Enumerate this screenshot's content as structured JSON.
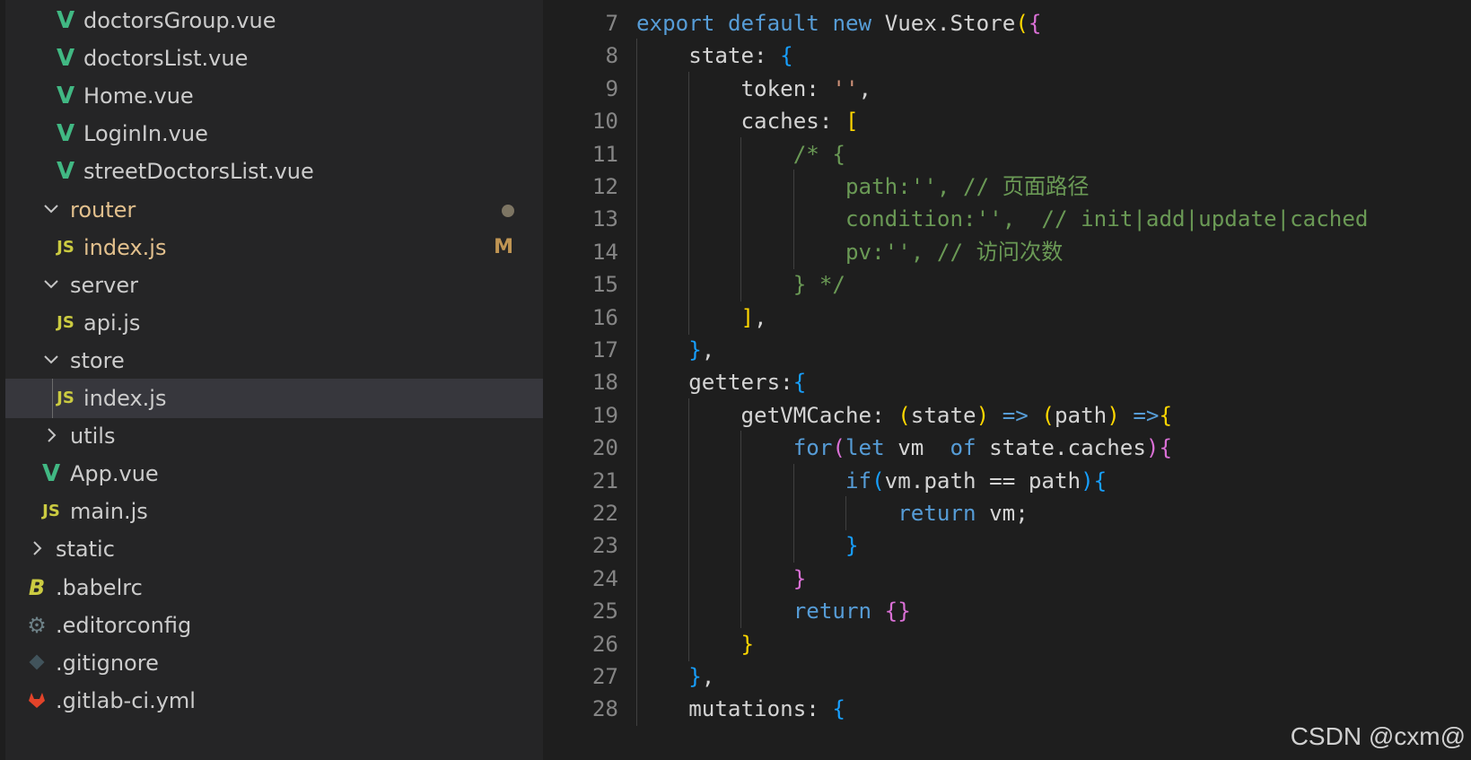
{
  "explorer": {
    "items": [
      {
        "label": "doctorsGroup.vue",
        "icon": "vue-icon",
        "indent": 2
      },
      {
        "label": "doctorsList.vue",
        "icon": "vue-icon",
        "indent": 2
      },
      {
        "label": "Home.vue",
        "icon": "vue-icon",
        "indent": 2
      },
      {
        "label": "LoginIn.vue",
        "icon": "vue-icon",
        "indent": 2
      },
      {
        "label": "streetDoctorsList.vue",
        "icon": "vue-icon",
        "indent": 2
      },
      {
        "label": "router",
        "icon": "chevron-down-icon",
        "indent": 1,
        "modified": true,
        "status": "dot"
      },
      {
        "label": "index.js",
        "icon": "js-icon",
        "indent": 2,
        "modified": true,
        "status": "M"
      },
      {
        "label": "server",
        "icon": "chevron-down-icon",
        "indent": 1
      },
      {
        "label": "api.js",
        "icon": "js-icon",
        "indent": 2
      },
      {
        "label": "store",
        "icon": "chevron-down-icon",
        "indent": 1
      },
      {
        "label": "index.js",
        "icon": "js-icon",
        "indent": 2,
        "selected": true
      },
      {
        "label": "utils",
        "icon": "chevron-right-icon",
        "indent": 1
      },
      {
        "label": "App.vue",
        "icon": "vue-icon",
        "indent": 1
      },
      {
        "label": "main.js",
        "icon": "js-icon",
        "indent": 1
      },
      {
        "label": "static",
        "icon": "chevron-right-icon",
        "indent": 0
      },
      {
        "label": ".babelrc",
        "icon": "babel-icon",
        "indent": 0
      },
      {
        "label": ".editorconfig",
        "icon": "gear-icon",
        "indent": 0
      },
      {
        "label": ".gitignore",
        "icon": "git-icon",
        "indent": 0
      },
      {
        "label": ".gitlab-ci.yml",
        "icon": "gitlab-icon",
        "indent": 0
      }
    ],
    "colors": {
      "modified": "#e2c08d",
      "selected_bg": "#37373d",
      "vue": "#41b883",
      "js": "#cbcb41"
    }
  },
  "editor": {
    "lines": [
      {
        "n": "7",
        "indent": 0,
        "tokens": [
          [
            "k",
            "export "
          ],
          [
            "k",
            "default "
          ],
          [
            "k",
            "new "
          ],
          [
            "t",
            "Vuex.Store"
          ],
          [
            "b1",
            "("
          ],
          [
            "b2",
            "{"
          ]
        ]
      },
      {
        "n": "8",
        "indent": 1,
        "tokens": [
          [
            "t",
            "state: "
          ],
          [
            "b3",
            "{"
          ]
        ]
      },
      {
        "n": "9",
        "indent": 2,
        "tokens": [
          [
            "t",
            "token: "
          ],
          [
            "s",
            "''"
          ],
          [
            "t",
            ","
          ]
        ]
      },
      {
        "n": "10",
        "indent": 2,
        "tokens": [
          [
            "t",
            "caches: "
          ],
          [
            "b1",
            "["
          ]
        ]
      },
      {
        "n": "11",
        "indent": 3,
        "tokens": [
          [
            "c",
            "/* {"
          ]
        ]
      },
      {
        "n": "12",
        "indent": 4,
        "tokens": [
          [
            "c",
            "path:'', // 页面路径"
          ]
        ]
      },
      {
        "n": "13",
        "indent": 4,
        "tokens": [
          [
            "c",
            "condition:'',  // init|add|update|cached"
          ]
        ]
      },
      {
        "n": "14",
        "indent": 4,
        "tokens": [
          [
            "c",
            "pv:'', // 访问次数"
          ]
        ]
      },
      {
        "n": "15",
        "indent": 3,
        "tokens": [
          [
            "c",
            "} */"
          ]
        ]
      },
      {
        "n": "16",
        "indent": 2,
        "tokens": [
          [
            "b1",
            "]"
          ],
          [
            "t",
            ","
          ]
        ]
      },
      {
        "n": "17",
        "indent": 1,
        "tokens": [
          [
            "b3",
            "}"
          ],
          [
            "t",
            ","
          ]
        ]
      },
      {
        "n": "18",
        "indent": 1,
        "tokens": [
          [
            "t",
            "getters:"
          ],
          [
            "b3",
            "{"
          ]
        ]
      },
      {
        "n": "19",
        "indent": 2,
        "tokens": [
          [
            "t",
            "getVMCache: "
          ],
          [
            "b1",
            "("
          ],
          [
            "t",
            "state"
          ],
          [
            "b1",
            ")"
          ],
          [
            "t",
            " "
          ],
          [
            "k",
            "=>"
          ],
          [
            "t",
            " "
          ],
          [
            "b1",
            "("
          ],
          [
            "t",
            "path"
          ],
          [
            "b1",
            ")"
          ],
          [
            "t",
            " "
          ],
          [
            "k",
            "=>"
          ],
          [
            "b1",
            "{"
          ]
        ]
      },
      {
        "n": "20",
        "indent": 3,
        "tokens": [
          [
            "k",
            "for"
          ],
          [
            "b2",
            "("
          ],
          [
            "k",
            "let "
          ],
          [
            "t",
            "vm  "
          ],
          [
            "k",
            "of "
          ],
          [
            "t",
            "state.caches"
          ],
          [
            "b2",
            ")"
          ],
          [
            "b2",
            "{"
          ]
        ]
      },
      {
        "n": "21",
        "indent": 4,
        "tokens": [
          [
            "k",
            "if"
          ],
          [
            "b3",
            "("
          ],
          [
            "t",
            "vm.path == path"
          ],
          [
            "b3",
            ")"
          ],
          [
            "b3",
            "{"
          ]
        ]
      },
      {
        "n": "22",
        "indent": 5,
        "tokens": [
          [
            "k",
            "return "
          ],
          [
            "t",
            "vm;"
          ]
        ]
      },
      {
        "n": "23",
        "indent": 4,
        "tokens": [
          [
            "b3",
            "}"
          ]
        ]
      },
      {
        "n": "24",
        "indent": 3,
        "tokens": [
          [
            "b2",
            "}"
          ]
        ]
      },
      {
        "n": "25",
        "indent": 3,
        "tokens": [
          [
            "k",
            "return "
          ],
          [
            "b2",
            "{}"
          ]
        ]
      },
      {
        "n": "26",
        "indent": 2,
        "tokens": [
          [
            "b1",
            "}"
          ]
        ]
      },
      {
        "n": "27",
        "indent": 1,
        "tokens": [
          [
            "b3",
            "}"
          ],
          [
            "t",
            ","
          ]
        ]
      },
      {
        "n": "28",
        "indent": 1,
        "tokens": [
          [
            "t",
            "mutations: "
          ],
          [
            "b3",
            "{"
          ]
        ]
      }
    ]
  },
  "watermark": "CSDN @cxm@"
}
